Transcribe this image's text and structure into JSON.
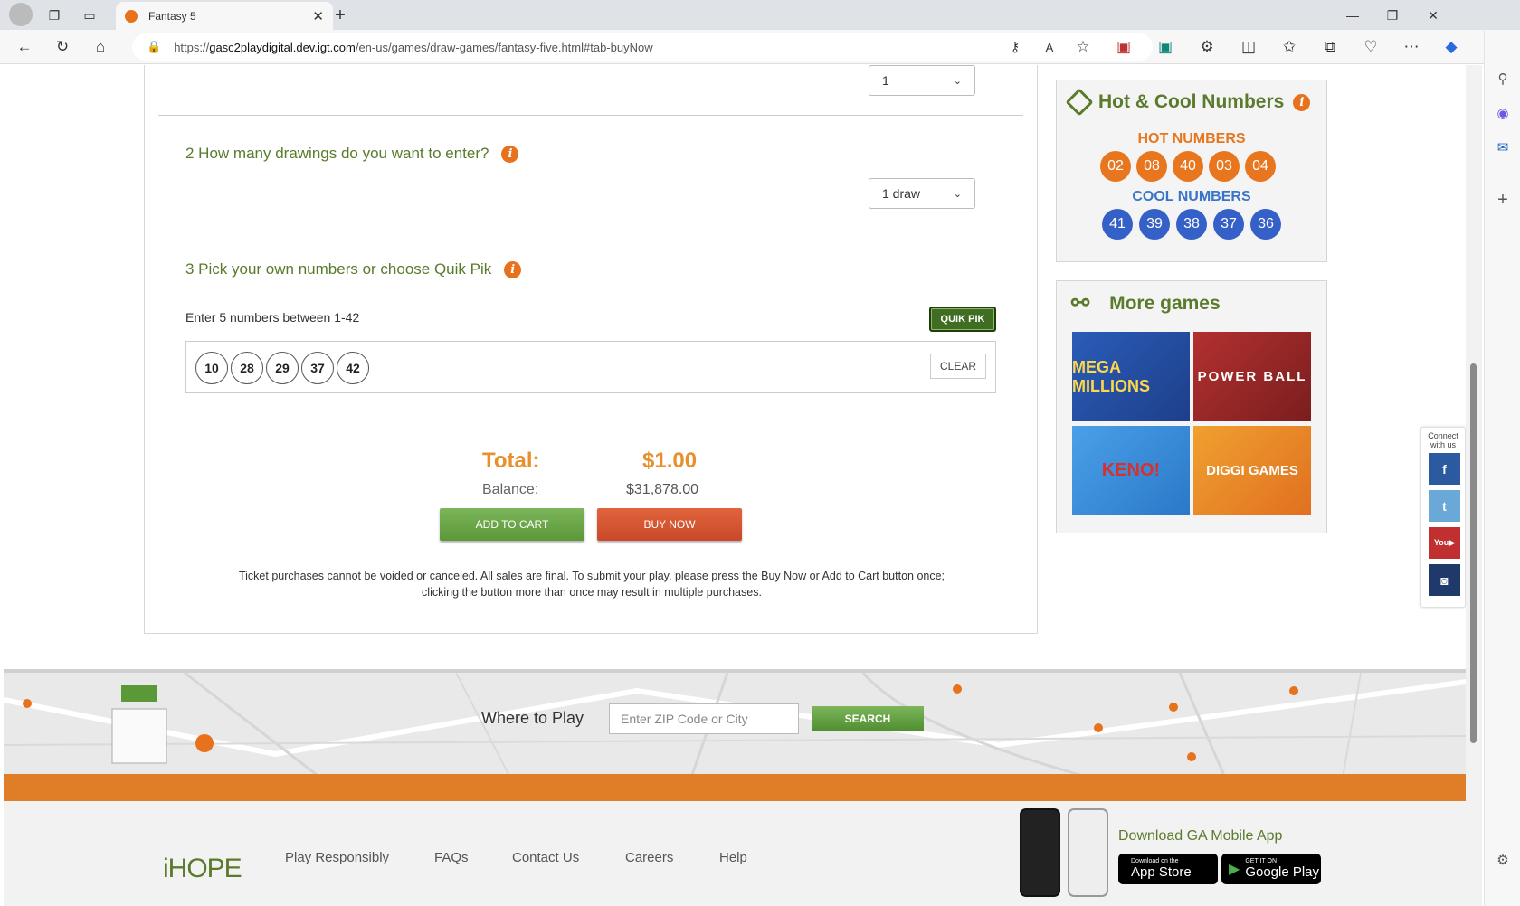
{
  "browser": {
    "tab_title": "Fantasy 5",
    "url_prefix": "https://",
    "url_host": "gasc2playdigital.dev.igt.com",
    "url_path": "/en-us/games/draw-games/fantasy-five.html#tab-buyNow"
  },
  "form": {
    "step1_select_value": "1",
    "step2_title": "2 How many drawings do you want to enter?",
    "step2_select_value": "1 draw",
    "step3_title": "3 Pick your own numbers or choose Quik Pik",
    "enter_hint": "Enter 5 numbers between 1-42",
    "quik_pik_label": "QUIK PIK",
    "picked_numbers": [
      "10",
      "28",
      "29",
      "37",
      "42"
    ],
    "clear_label": "CLEAR",
    "total_label": "Total:",
    "total_value": "$1.00",
    "balance_label": "Balance:",
    "balance_value": "$31,878.00",
    "add_to_cart_label": "ADD TO CART",
    "buy_now_label": "BUY NOW",
    "disclaimer": "Ticket purchases cannot be voided or canceled. All sales are final. To submit your play, please press the Buy Now or Add to Cart button once; clicking the button more than once may result in multiple purchases."
  },
  "hot_cool": {
    "title": "Hot & Cool Numbers",
    "hot_label": "HOT NUMBERS",
    "hot_numbers": [
      "02",
      "08",
      "40",
      "03",
      "04"
    ],
    "cool_label": "COOL NUMBERS",
    "cool_numbers": [
      "41",
      "39",
      "38",
      "37",
      "36"
    ],
    "hot_color": "#e8761e",
    "cool_color": "#3560c8"
  },
  "more_games": {
    "title": "More games",
    "games": [
      "MEGA MILLIONS",
      "POWER BALL",
      "KENO!",
      "DIGGI GAMES"
    ]
  },
  "social": {
    "connect_label": "Connect with us",
    "icons": [
      "facebook-icon",
      "twitter-icon",
      "youtube-icon",
      "instagram-icon"
    ]
  },
  "where_to_play": {
    "label": "Where to Play",
    "placeholder": "Enter ZIP Code or City",
    "search_label": "SEARCH"
  },
  "footer": {
    "links": [
      "Play Responsibly",
      "FAQs",
      "Contact Us",
      "Careers",
      "Help"
    ],
    "download_label": "Download GA Mobile App",
    "app_store_small": "Download on the",
    "app_store_big": "App Store",
    "google_play_small": "GET IT ON",
    "google_play_big": "Google Play",
    "logo_text": "iHOPE"
  }
}
